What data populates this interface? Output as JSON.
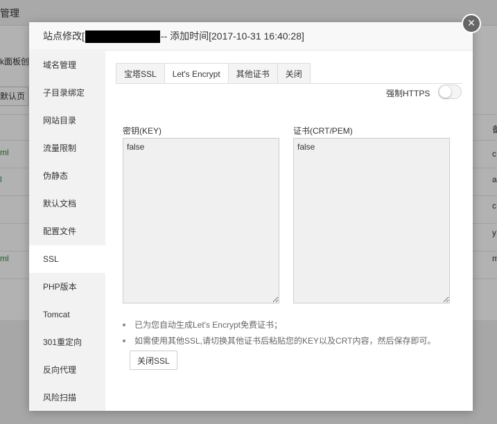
{
  "background": {
    "header_title": "管理",
    "side_text_1": "k面板创",
    "side_button": "默认页",
    "left_rows": [
      "ml",
      "l",
      "ml"
    ],
    "right_header": "备",
    "right_rows": [
      "c",
      "a",
      "c",
      "y",
      "m"
    ]
  },
  "dialog": {
    "title_prefix": "站点修改[",
    "title_suffix": "-- 添加时间[2017-10-31 16:40:28]",
    "close_symbol": "×"
  },
  "sidebar": {
    "items": [
      "域名管理",
      "子目录绑定",
      "网站目录",
      "流量限制",
      "伪静态",
      "默认文档",
      "配置文件",
      "SSL",
      "PHP版本",
      "Tomcat",
      "301重定向",
      "反向代理",
      "风险扫描"
    ],
    "active": "SSL"
  },
  "tabs": [
    "宝塔SSL",
    "Let's Encrypt",
    "其他证书",
    "关闭"
  ],
  "active_tab": "Let's Encrypt",
  "force_https": {
    "label": "强制HTTPS",
    "enabled": false
  },
  "key_field": {
    "label": "密钥(KEY)",
    "value": "false"
  },
  "cert_field": {
    "label": "证书(CRT/PEM)",
    "value": "false"
  },
  "tips": [
    "已为您自动生成Let's Encrypt免费证书；",
    "如需使用其他SSL,请切换其他证书后粘贴您的KEY以及CRT内容，然后保存即可。"
  ],
  "close_ssl_button": "关闭SSL"
}
